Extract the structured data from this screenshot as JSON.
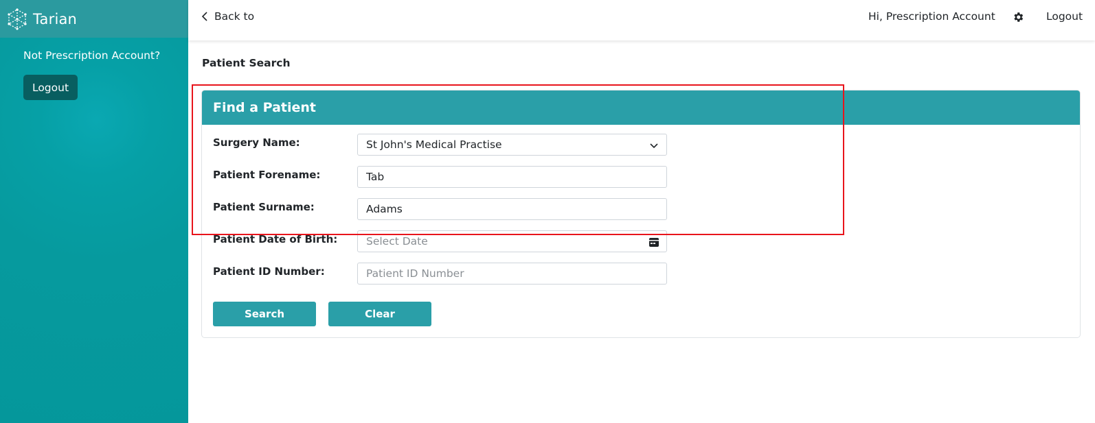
{
  "brand": {
    "name": "Tarian"
  },
  "sidebar": {
    "not_account_text": "Not Prescription Account?",
    "logout_label": "Logout"
  },
  "topbar": {
    "back_label": "Back to",
    "greeting": "Hi, Prescription Account",
    "logout_label": "Logout"
  },
  "page": {
    "heading": "Patient Search"
  },
  "form": {
    "title": "Find a Patient",
    "surgery": {
      "label": "Surgery Name:",
      "value": "St John's Medical Practise"
    },
    "forename": {
      "label": "Patient Forename:",
      "value": "Tab"
    },
    "surname": {
      "label": "Patient Surname:",
      "value": "Adams"
    },
    "dob": {
      "label": "Patient Date of Birth:",
      "placeholder": "Select Date"
    },
    "patient_id": {
      "label": "Patient ID Number:",
      "placeholder": "Patient ID Number"
    },
    "search_label": "Search",
    "clear_label": "Clear"
  },
  "colors": {
    "sidebar": "#069a9e",
    "brand_bar": "#2b9a9f",
    "sidebar_button": "#085e60",
    "accent": "#2a9fa8",
    "highlight": "#e8141b"
  },
  "icons": {
    "logo": "tarian-logo-icon",
    "back": "chevron-left-icon",
    "settings": "gear-icon",
    "select": "chevron-down-icon",
    "date": "calendar-icon"
  }
}
